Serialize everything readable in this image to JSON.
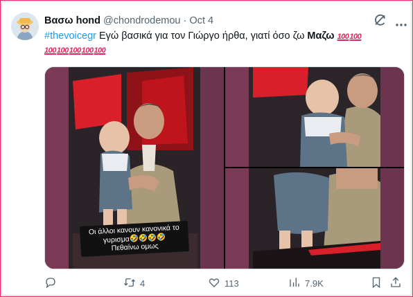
{
  "tweet": {
    "display_name": "Βασω hond",
    "handle": "@chondrodemou",
    "separator": "·",
    "date": "Oct 4",
    "text": {
      "hashtag": "#thevoicegr",
      "body": " Εγώ βασικά  για τον Γιώργο  ήρθα, γιατί  όσο  ζω ",
      "bold_word": "Μαζω",
      "emoji": "💯",
      "emoji_badge": "100"
    },
    "media": {
      "caption_line1": "Οι άλλοι κανουν κανονικά το",
      "caption_line2": "γυρισμα🤣🤣🤣🤣",
      "caption_line3": "Πεθαίνω ομως"
    },
    "actions": {
      "reply_count": "",
      "retweet_count": "4",
      "like_count": "113",
      "views_count": "7.9K"
    }
  },
  "colors": {
    "accent": "#1d9bf0",
    "emoji_red": "#e0245e",
    "muted": "#536471",
    "frame": "#e0245e"
  },
  "icons": {
    "grok": "grok-icon",
    "more": "more-icon",
    "reply": "reply-icon",
    "retweet": "retweet-icon",
    "like": "like-icon",
    "views": "views-icon",
    "bookmark": "bookmark-icon",
    "share": "share-icon"
  }
}
